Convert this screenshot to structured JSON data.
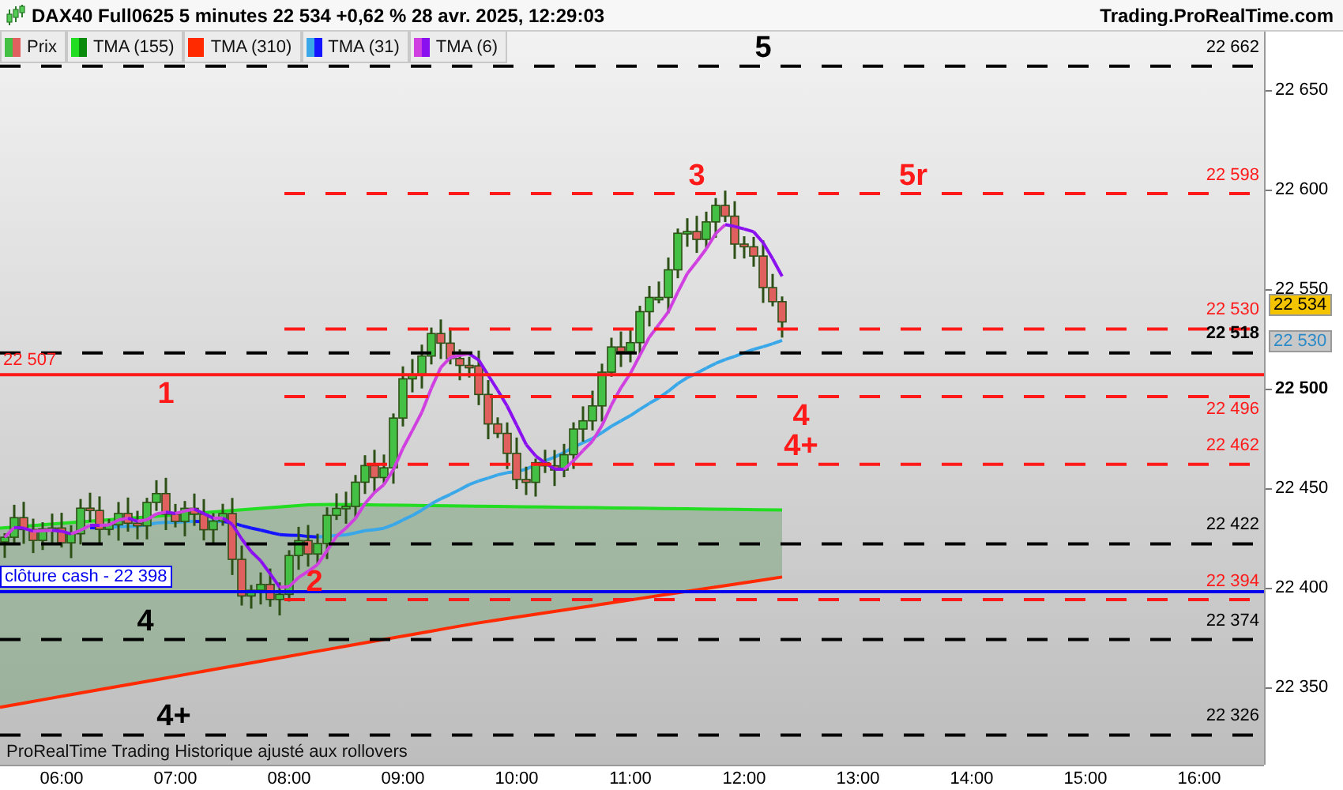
{
  "header": {
    "title": "DAX40 Full0625 5 minutes 22 534 +0,62 % 28 avr. 2025, 12:29:03",
    "source": "Trading.ProRealTime.com"
  },
  "legend": [
    {
      "label": "Prix",
      "color": "#44c044"
    },
    {
      "label": "TMA (155)",
      "color": "#22dd22"
    },
    {
      "label": "TMA (310)",
      "color": "#ff2a00"
    },
    {
      "label": "TMA (31)",
      "color": "#3aa8e8"
    },
    {
      "label": "TMA (6)",
      "color": "#d040e0"
    }
  ],
  "levels": [
    {
      "label": "22 662",
      "kind": "dashed",
      "color": "#000000",
      "bold": false,
      "marks": [
        "5"
      ]
    },
    {
      "label": "22 598",
      "kind": "dashed",
      "color": "#ff1a1a",
      "bold": false,
      "marks": [
        "3",
        "5r"
      ]
    },
    {
      "label": "22 530",
      "kind": "dashed",
      "color": "#ff1a1a",
      "bold": false
    },
    {
      "label": "22 518",
      "kind": "dashed",
      "color": "#000000",
      "bold": true
    },
    {
      "label": "22 507",
      "kind": "solid",
      "color": "#ff1a1a",
      "bold": false,
      "marks": [
        "1"
      ]
    },
    {
      "label": "22 496",
      "kind": "dashed",
      "color": "#ff1a1a",
      "bold": false,
      "marks": [
        "4"
      ]
    },
    {
      "label": "22 462",
      "kind": "dashed",
      "color": "#ff1a1a",
      "bold": false,
      "marks": [
        "4+"
      ]
    },
    {
      "label": "22 422",
      "kind": "dashed",
      "color": "#000000",
      "bold": false
    },
    {
      "label": "clôture cash -  22 398",
      "kind": "solid",
      "color": "#0000ee",
      "bold": false
    },
    {
      "label": "22 394",
      "kind": "dashed",
      "color": "#ff1a1a",
      "bold": false,
      "marks": [
        "2"
      ]
    },
    {
      "label": "22 374",
      "kind": "dashed",
      "color": "#000000",
      "bold": false,
      "marks": [
        "4"
      ]
    },
    {
      "label": "22 326",
      "kind": "dashed",
      "color": "#000000",
      "bold": false,
      "marks": [
        "4+"
      ]
    }
  ],
  "price_axis": [
    {
      "label": "22 650",
      "bold": false
    },
    {
      "label": "22 600",
      "bold": false
    },
    {
      "label": "22 550",
      "bold": false
    },
    {
      "label": "22 500",
      "bold": true
    },
    {
      "label": "22 450",
      "bold": false
    },
    {
      "label": "22 400",
      "bold": false
    },
    {
      "label": "22 350",
      "bold": false
    }
  ],
  "price_tags": [
    {
      "label": "22 534",
      "kind": "last"
    },
    {
      "label": "22 530",
      "kind": "average"
    }
  ],
  "time_axis": [
    "06:00",
    "07:00",
    "08:00",
    "09:00",
    "10:00",
    "11:00",
    "12:00",
    "13:00",
    "14:00",
    "15:00",
    "16:00"
  ],
  "footer": "ProRealTime Trading  Historique ajusté aux rollovers"
}
